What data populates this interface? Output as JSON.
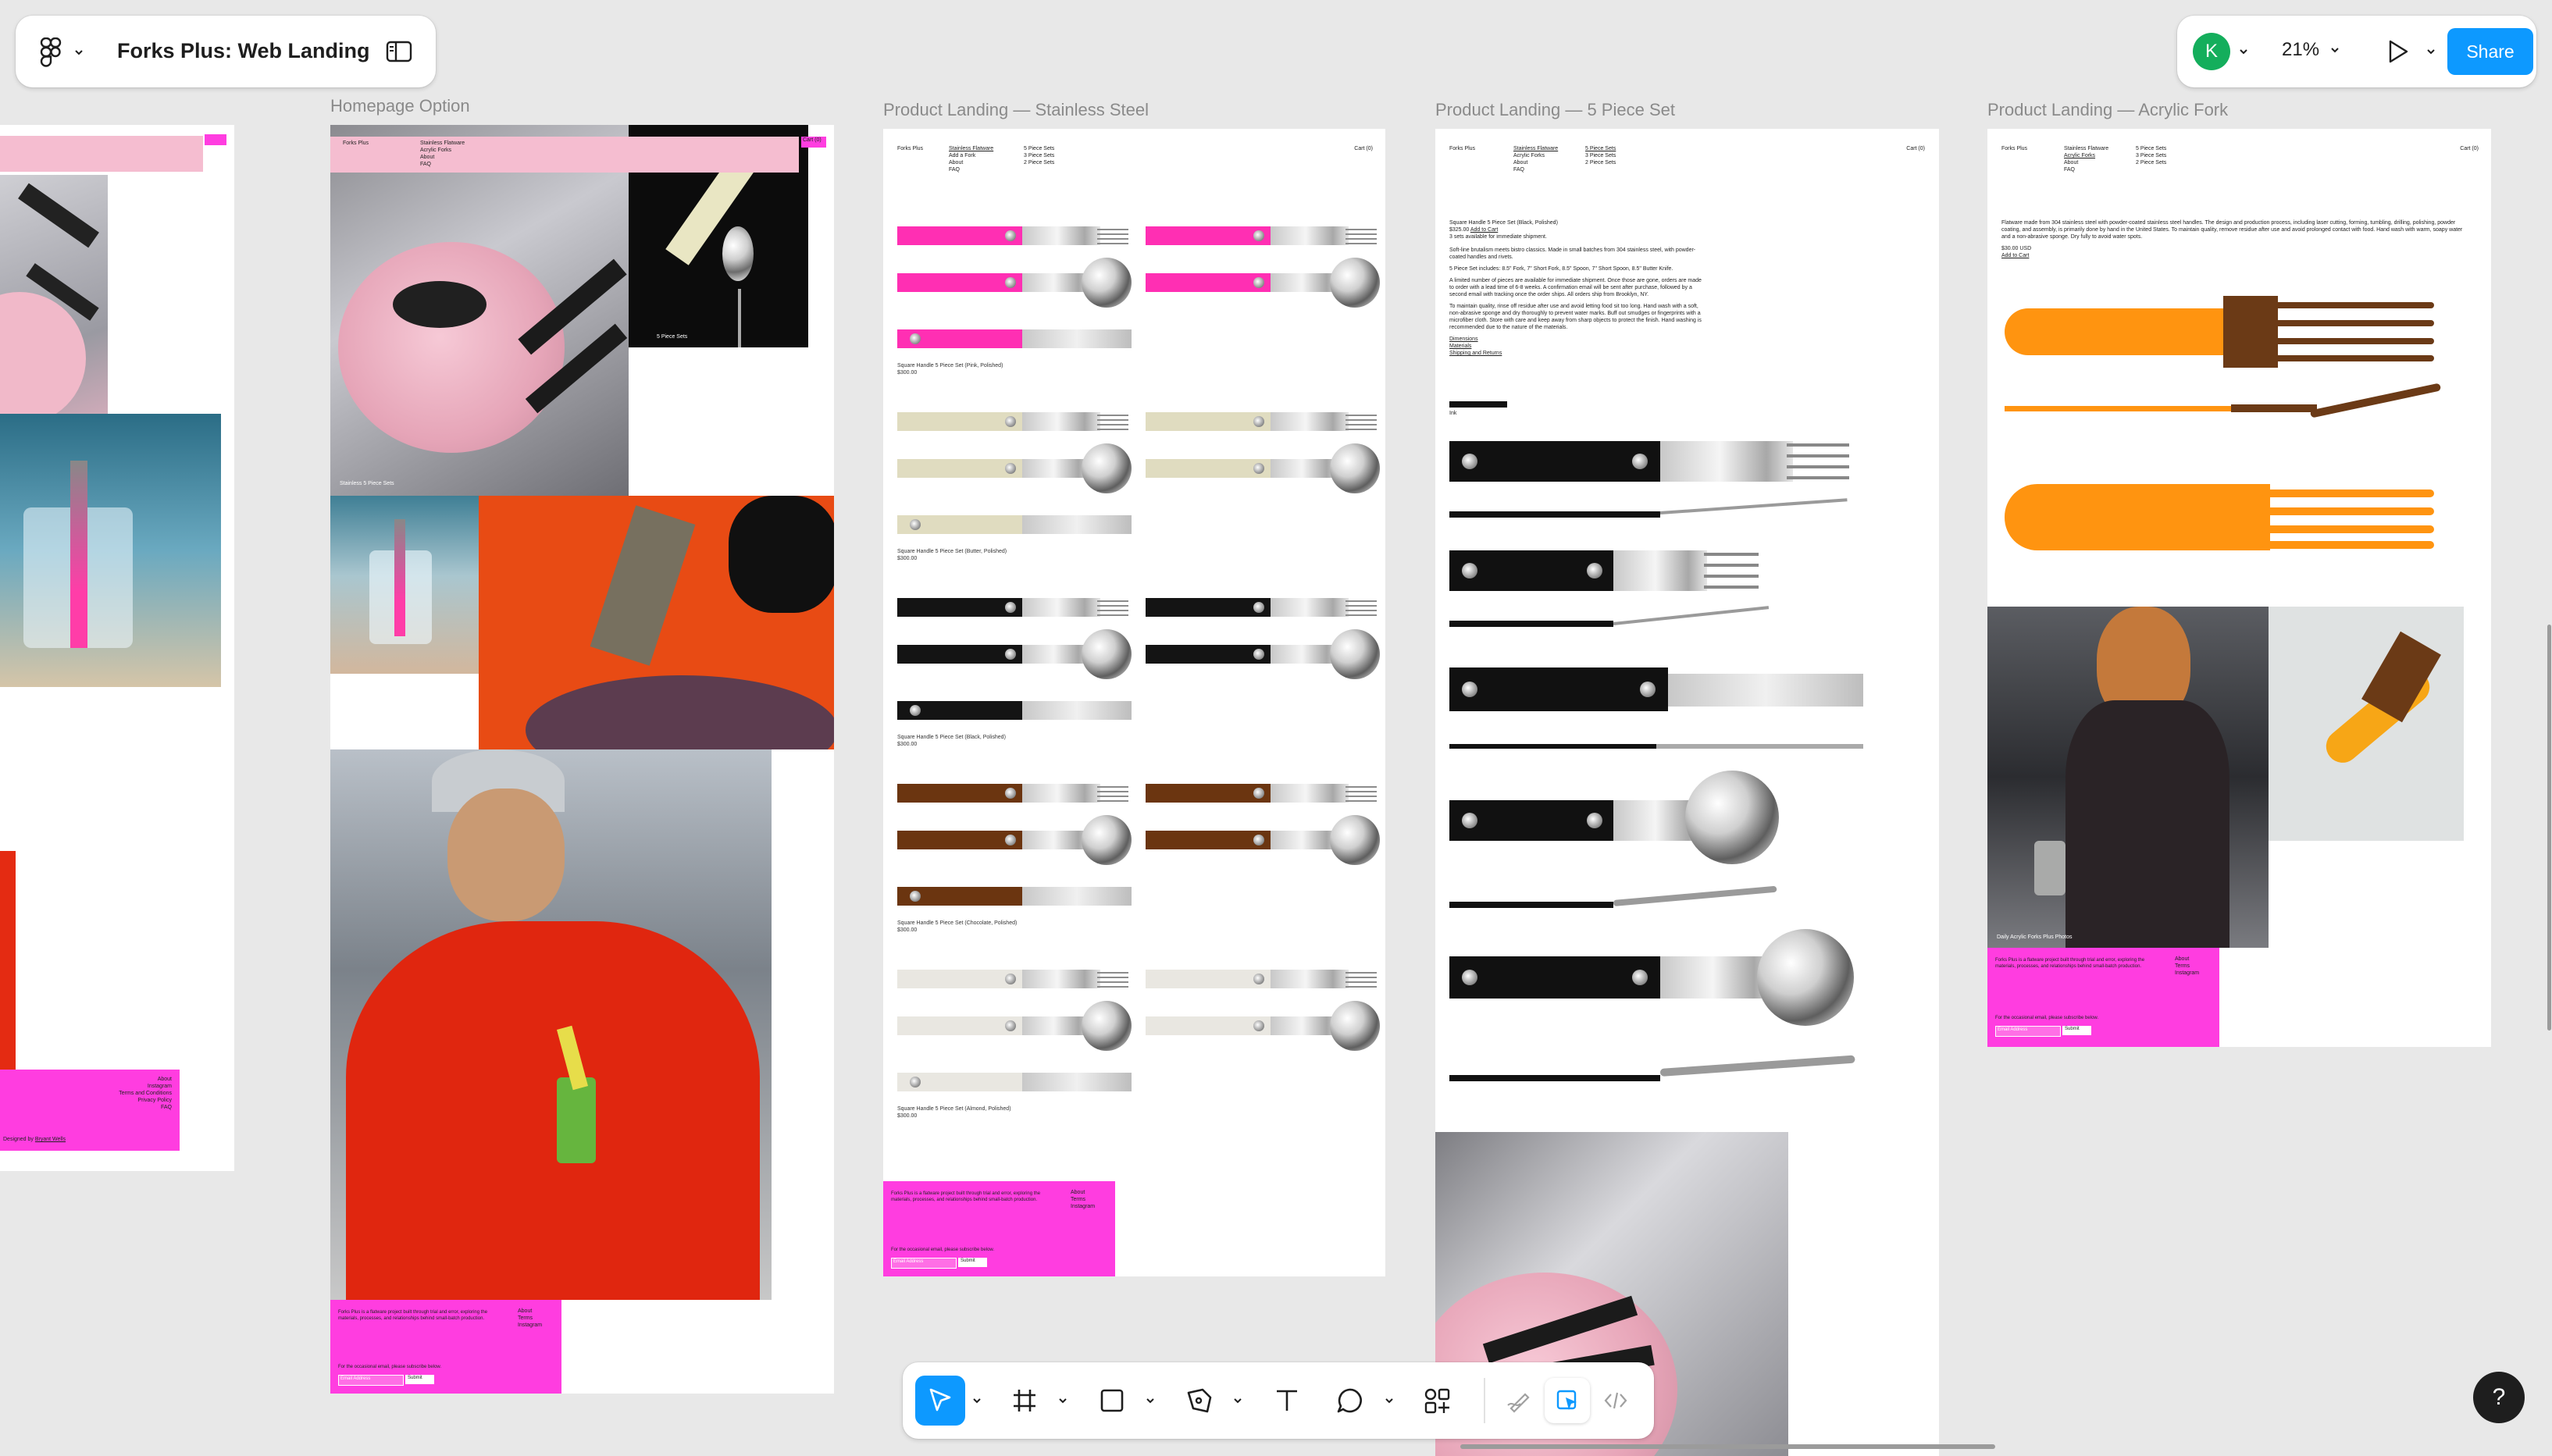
{
  "app": {
    "file_title": "Forks Plus: Web Landing"
  },
  "topbar": {
    "avatar_initial": "K",
    "zoom": "21%",
    "share_label": "Share",
    "accent": "#0d99ff",
    "avatar_color": "#14ae5c"
  },
  "frames": [
    {
      "label": "Homepage Option"
    },
    {
      "label": "Product Landing — Stainless Steel"
    },
    {
      "label": "Product Landing — 5 Piece Set"
    },
    {
      "label": "Product Landing — Acrylic Fork"
    }
  ],
  "site": {
    "brand": "Forks Plus",
    "cart": "Cart (0)",
    "nav": [
      "Stainless Flatware",
      "Acrylic Forks",
      "About",
      "FAQ"
    ],
    "nav_sets": [
      "5 Piece Sets",
      "3 Piece Sets",
      "2 Piece Sets"
    ],
    "nav_add": [
      "Add a Fork"
    ],
    "footer_links": [
      "About",
      "Instagram",
      "Terms and Conditions",
      "Privacy Policy",
      "FAQ"
    ],
    "footer_links_short": [
      "About",
      "Terms",
      "Instagram"
    ],
    "footer_blurb": "Forks Plus is a flatware project built through trial and error, exploring the materials, processes, and relationships behind small-batch production.",
    "subscribe_prompt": "For the occasional email, please subscribe below.",
    "email_placeholder": "Email Address",
    "submit_label": "Submit",
    "designed_by": "Designed by",
    "designer": "Bryant Wells",
    "stainless_sets_caption": "Stainless 5 Piece Sets",
    "five_piece_caption": "5 Piece Sets",
    "acrylic_caption": "Daily Acrylic Forks Plus Photos"
  },
  "stainless": {
    "variants": [
      {
        "name": "Square Handle 5 Piece Set (Pink, Polished)",
        "price": "$300.00",
        "color": "#ff2fb3"
      },
      {
        "name": "Square Handle 5 Piece Set (Butter, Polished)",
        "price": "$300.00",
        "color": "#e0dcc0"
      },
      {
        "name": "Square Handle 5 Piece Set (Black, Polished)",
        "price": "$300.00",
        "color": "#141414"
      },
      {
        "name": "Square Handle 5 Piece Set (Chocolate, Polished)",
        "price": "$300.00",
        "color": "#6b3510"
      },
      {
        "name": "Square Handle 5 Piece Set (Almond, Polished)",
        "price": "$300.00",
        "color": "#e9e7e1"
      }
    ]
  },
  "five_piece": {
    "title": "Square Handle 5 Piece Set (Black, Polished)",
    "price": "$325.00",
    "add_to_cart": "Add to Cart",
    "availability": "3 sets available for immediate shipment.",
    "para1": "Soft-line brutalism meets bistro classics. Made in small batches from 304 stainless steel, with powder-coated handles and rivets.",
    "para2": "5 Piece Set includes: 8.5\" Fork, 7\" Short Fork, 8.5\" Spoon, 7\" Short Spoon, 8.5\" Butter Knife.",
    "para3": "A limited number of pieces are available for immediate shipment. Once those are gone, orders are made to order with a lead time of 6-8 weeks. A confirmation email will be sent after purchase, followed by a second email with tracking once the order ships. All orders ship from Brooklyn, NY.",
    "para4": "To maintain quality, rinse off residue after use and avoid letting food sit too long. Hand wash with a soft, non-abrasive sponge and dry thoroughly to prevent water marks. Buff out smudges or fingerprints with a microfiber cloth. Store with care and keep away from sharp objects to protect the finish. Hand washing is recommended due to the nature of the materials.",
    "links": [
      "Dimensions",
      "Materials",
      "Shipping and Returns"
    ],
    "swatch_label": "Ink"
  },
  "acrylic": {
    "desc": "Flatware made from 304 stainless steel with powder-coated stainless steel handles. The design and production process, including laser cutting, forming, tumbling, drilling, polishing, powder coating, and assembly, is primarily done by hand in the United States. To maintain quality, remove residue after use and avoid prolonged contact with food. Hand wash with warm, soapy water and a non-abrasive sponge. Dry fully to avoid water spots.",
    "price": "$30.00 USD",
    "add_to_cart": "Add to Cart"
  },
  "toolbar": {
    "tools": [
      "move-tool",
      "frame-tool",
      "shape-tool",
      "pen-tool",
      "text-tool",
      "comment-tool",
      "actions-tool",
      "draw-mode",
      "design-mode",
      "dev-mode"
    ]
  },
  "help": {
    "label": "?"
  }
}
